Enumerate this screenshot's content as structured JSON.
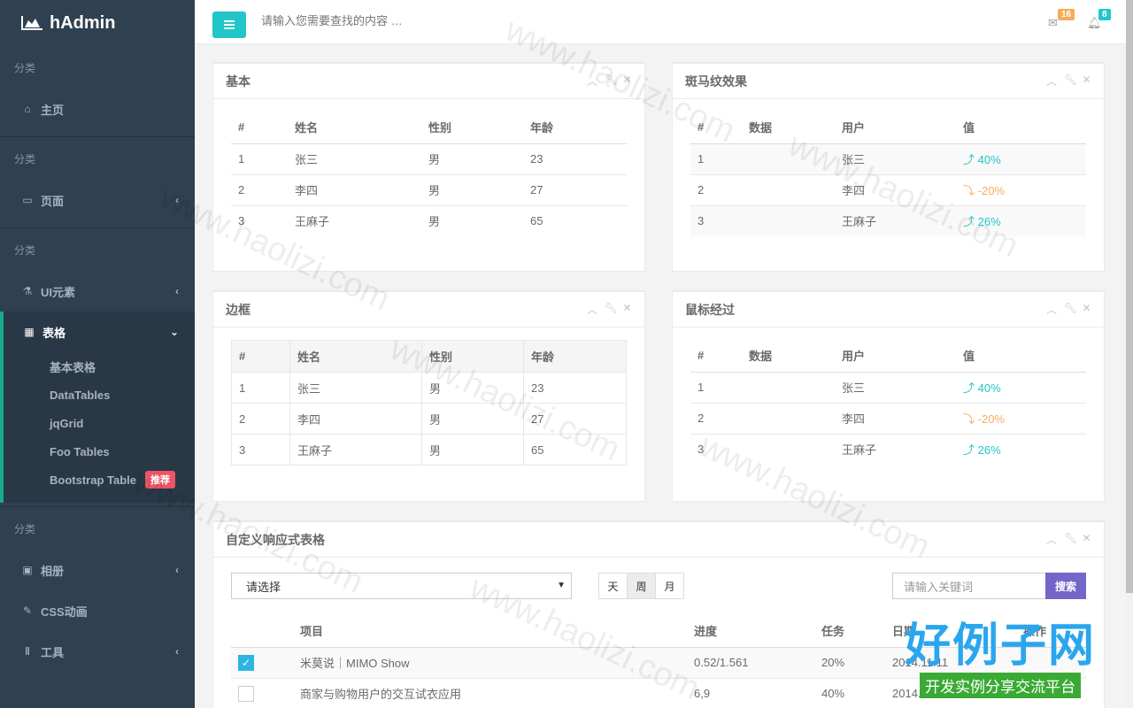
{
  "app": {
    "title": "hAdmin"
  },
  "sidebar": {
    "cat1": "分类",
    "home": "主页",
    "cat2": "分类",
    "pages": "页面",
    "cat3": "分类",
    "ui": "UI元素",
    "tables": "表格",
    "sub": [
      "基本表格",
      "DataTables",
      "jqGrid",
      "Foo Tables",
      "Bootstrap Table"
    ],
    "recommend_badge": "推荐",
    "cat4": "分类",
    "album": "相册",
    "css": "CSS动画",
    "tools": "工具"
  },
  "topbar": {
    "search_placeholder": "请输入您需要查找的内容 …",
    "mail_count": "16",
    "bell_count": "8",
    "mail_badge_color": "#f8ac59",
    "bell_badge_color": "#23c6c8"
  },
  "panels": {
    "basic": {
      "title": "基本",
      "headers": [
        "#",
        "姓名",
        "性别",
        "年龄"
      ],
      "rows": [
        [
          "1",
          "张三",
          "男",
          "23"
        ],
        [
          "2",
          "李四",
          "男",
          "27"
        ],
        [
          "3",
          "王麻子",
          "男",
          "65"
        ]
      ]
    },
    "zebra": {
      "title": "斑马纹效果",
      "headers": [
        "#",
        "数据",
        "用户",
        "值"
      ],
      "rows": [
        [
          "1",
          "",
          "张三",
          "40%"
        ],
        [
          "2",
          "",
          "李四",
          "-20%"
        ],
        [
          "3",
          "",
          "王麻子",
          "26%"
        ]
      ]
    },
    "border": {
      "title": "边框",
      "headers": [
        "#",
        "姓名",
        "性别",
        "年龄"
      ],
      "rows": [
        [
          "1",
          "张三",
          "男",
          "23"
        ],
        [
          "2",
          "李四",
          "男",
          "27"
        ],
        [
          "3",
          "王麻子",
          "男",
          "65"
        ]
      ]
    },
    "hover": {
      "title": "鼠标经过",
      "headers": [
        "#",
        "数据",
        "用户",
        "值"
      ],
      "rows": [
        [
          "1",
          "",
          "张三",
          "40%"
        ],
        [
          "2",
          "",
          "李四",
          "-20%"
        ],
        [
          "3",
          "",
          "王麻子",
          "26%"
        ]
      ]
    },
    "custom": {
      "title": "自定义响应式表格",
      "select_value": "请选择",
      "period_buttons": [
        "天",
        "周",
        "月"
      ],
      "keyword_placeholder": "请输入关键词",
      "search_button": "搜索",
      "headers": [
        "",
        "项目",
        "进度",
        "任务",
        "日期",
        "操作"
      ],
      "rows": [
        [
          "",
          "米莫说｜MIMO Show",
          "0.52/1.561",
          "20%",
          "2014.11.11",
          ""
        ],
        [
          "",
          "商家与购物用户的交互试衣应用",
          "6,9",
          "40%",
          "2014.11.11",
          ""
        ]
      ]
    }
  },
  "watermark": {
    "text": "www.haolizi.com",
    "brand_big": "好例子网",
    "brand_small": "开发实例分享交流平台"
  }
}
